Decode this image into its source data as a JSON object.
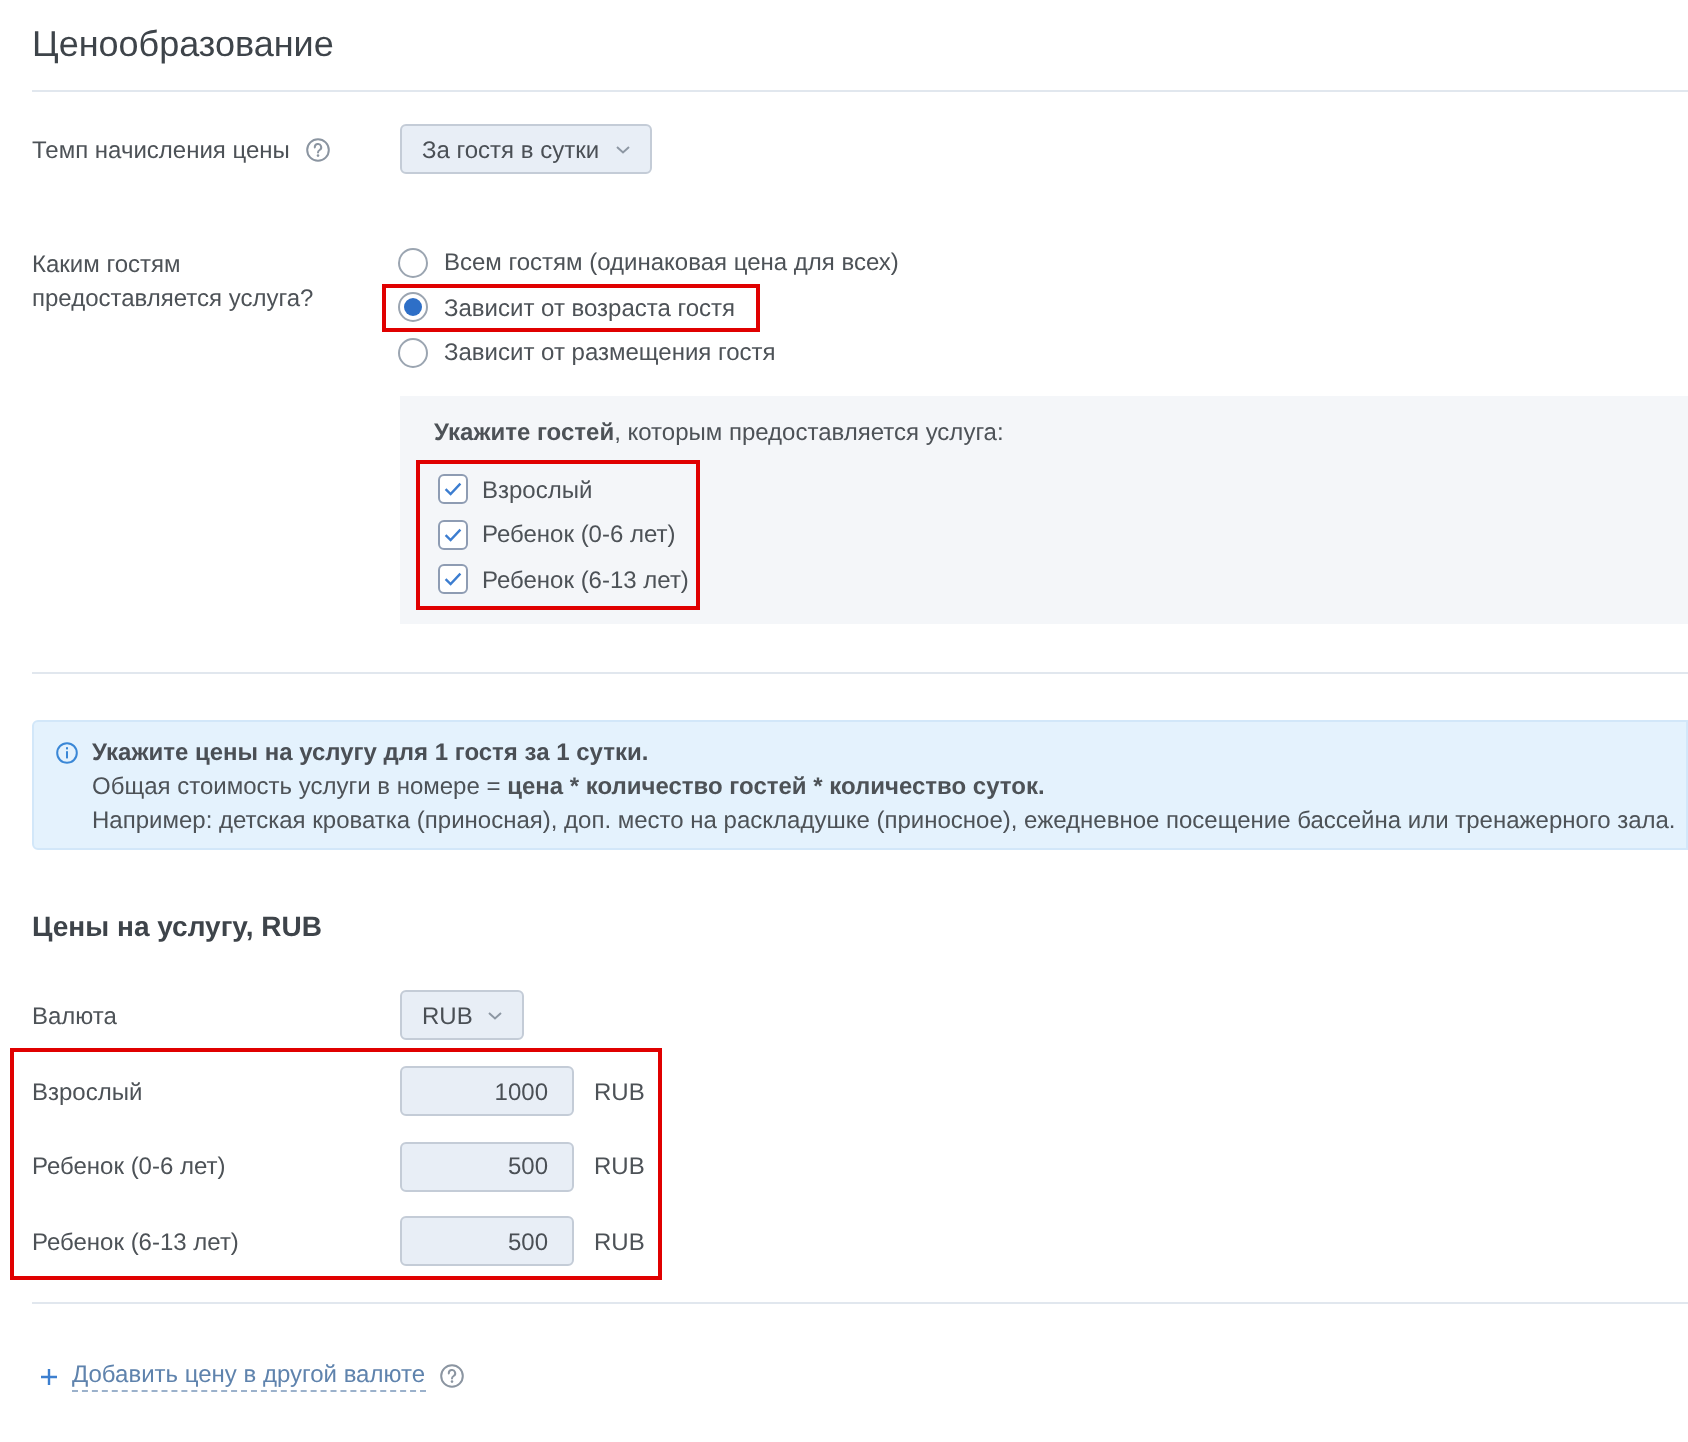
{
  "pricing": {
    "title": "Ценообразование"
  },
  "rate": {
    "label": "Темп начисления цены",
    "value": "За гостя в сутки"
  },
  "guest_pricing": {
    "label": "Каким гостям предоставляется услуга?",
    "options": [
      {
        "label": "Всем гостям (одинаковая цена для всех)",
        "selected": false,
        "highlighted": false
      },
      {
        "label": "Зависит от возраста гостя",
        "selected": true,
        "highlighted": true
      },
      {
        "label": "Зависит от размещения гостя",
        "selected": false,
        "highlighted": false
      }
    ]
  },
  "guest_panel": {
    "heading": "**Укажите гостей**, которым предоставляется услуга:",
    "highlighted": true,
    "guests": [
      {
        "label": "Взрослый",
        "checked": true
      },
      {
        "label": "Ребенок (0-6 лет)",
        "checked": true
      },
      {
        "label": "Ребенок (6-13 лет)",
        "checked": true
      }
    ]
  },
  "info": {
    "title": "Укажите цены на услугу для 1 гостя за 1 сутки.",
    "lines": [
      "Общая стоимость услуги в номере = **цена * количество гостей * количество суток.**",
      "Например: детская кроватка (приносная), доп. место на раскладушке (приносное), ежедневное посещение бассейна или тренажерного зала."
    ]
  },
  "prices": {
    "title": "Цены на услугу, RUB",
    "currency": {
      "label": "Валюта",
      "value": "RUB"
    },
    "highlighted": true,
    "rows": [
      {
        "label": "Взрослый",
        "value": "1000",
        "unit": "RUB"
      },
      {
        "label": "Ребенок (0-6 лет)",
        "value": "500",
        "unit": "RUB"
      },
      {
        "label": "Ребенок (6-13 лет)",
        "value": "500",
        "unit": "RUB"
      }
    ]
  },
  "add_currency": {
    "label": "Добавить цену в другой валюте"
  }
}
